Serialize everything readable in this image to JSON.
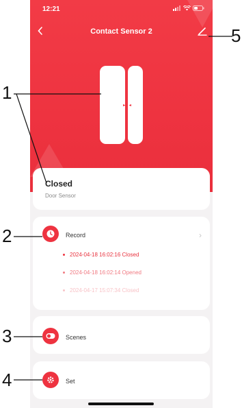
{
  "status_bar": {
    "time": "12:21"
  },
  "header": {
    "title": "Contact Sensor 2",
    "back_icon": "chevron-left-icon",
    "edit_icon": "pencil-icon"
  },
  "device_status": {
    "state": "Closed",
    "type": "Door Sensor"
  },
  "record": {
    "label": "Record",
    "entries": [
      "2024-04-18 16:02:16 Closed",
      "2024-04-18 16:02:14 Opened",
      "2024-04-17 15:07:34 Closed"
    ]
  },
  "scenes": {
    "label": "Scenes"
  },
  "set": {
    "label": "Set"
  },
  "annotations": [
    "1",
    "2",
    "3",
    "4",
    "5"
  ],
  "colors": {
    "accent": "#ee3340",
    "background": "#f4f2f3"
  }
}
